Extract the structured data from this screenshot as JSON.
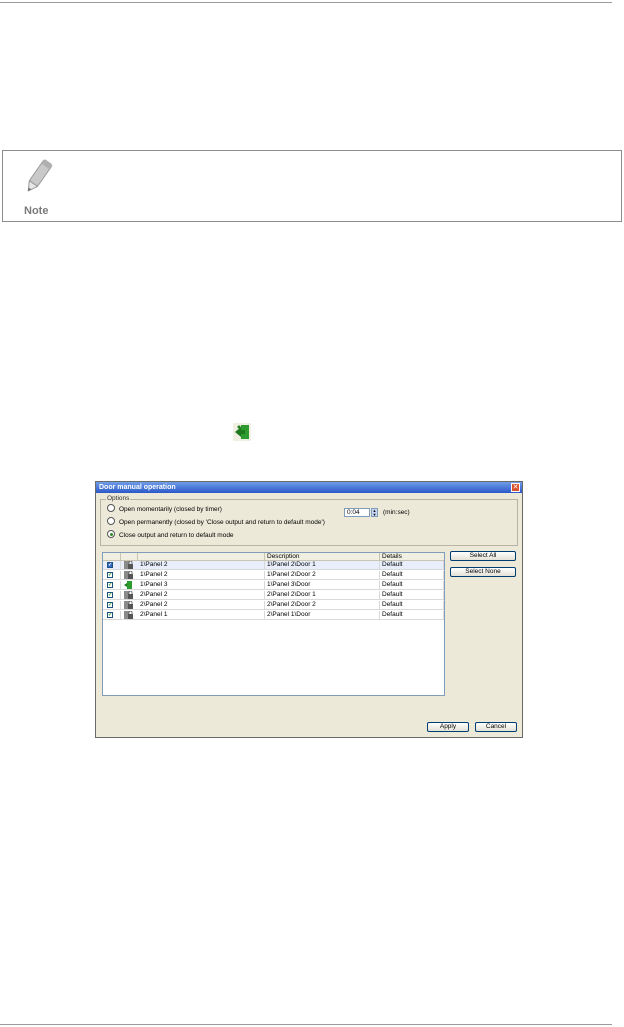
{
  "note": {
    "label": "Note"
  },
  "dialog": {
    "title": "Door manual operation",
    "close_glyph": "✕",
    "options": {
      "legend": "Options",
      "items": [
        {
          "label": "Open momentarily (closed by timer)",
          "checked": false
        },
        {
          "label": "Open permanently (closed by 'Close output and return to default mode')",
          "checked": false
        },
        {
          "label": "Close output and return to default mode",
          "checked": true
        }
      ],
      "time_value": "0:04",
      "time_unit": "(min:sec)"
    },
    "table": {
      "columns": [
        "",
        "",
        "",
        "Description",
        "Details"
      ],
      "rows": [
        {
          "checked": true,
          "icon": "lock-icon",
          "name": "1\\Panel 2",
          "description": "1\\Panel 2\\Door 1",
          "details": "Default",
          "selected": true
        },
        {
          "checked": true,
          "icon": "lock-icon",
          "name": "1\\Panel 2",
          "description": "1\\Panel 2\\Door 2",
          "details": "Default",
          "selected": false
        },
        {
          "checked": true,
          "icon": "door-open-icon",
          "name": "1\\Panel 3",
          "description": "1\\Panel 3\\Door",
          "details": "Default",
          "selected": false
        },
        {
          "checked": true,
          "icon": "lock-icon",
          "name": "2\\Panel 2",
          "description": "2\\Panel 2\\Door 1",
          "details": "Default",
          "selected": false
        },
        {
          "checked": true,
          "icon": "lock-icon",
          "name": "2\\Panel 2",
          "description": "2\\Panel 2\\Door 2",
          "details": "Default",
          "selected": false
        },
        {
          "checked": true,
          "icon": "lock-icon",
          "name": "2\\Panel 1",
          "description": "2\\Panel 1\\Door",
          "details": "Default",
          "selected": false
        }
      ]
    },
    "buttons": {
      "select_all": "Select All",
      "select_none": "Select None",
      "apply": "Apply",
      "cancel": "Cancel"
    }
  },
  "colors": {
    "titlebar": "#2a58c9",
    "dialog_bg": "#ece9d8",
    "exit_icon": "#2e9b2e"
  }
}
